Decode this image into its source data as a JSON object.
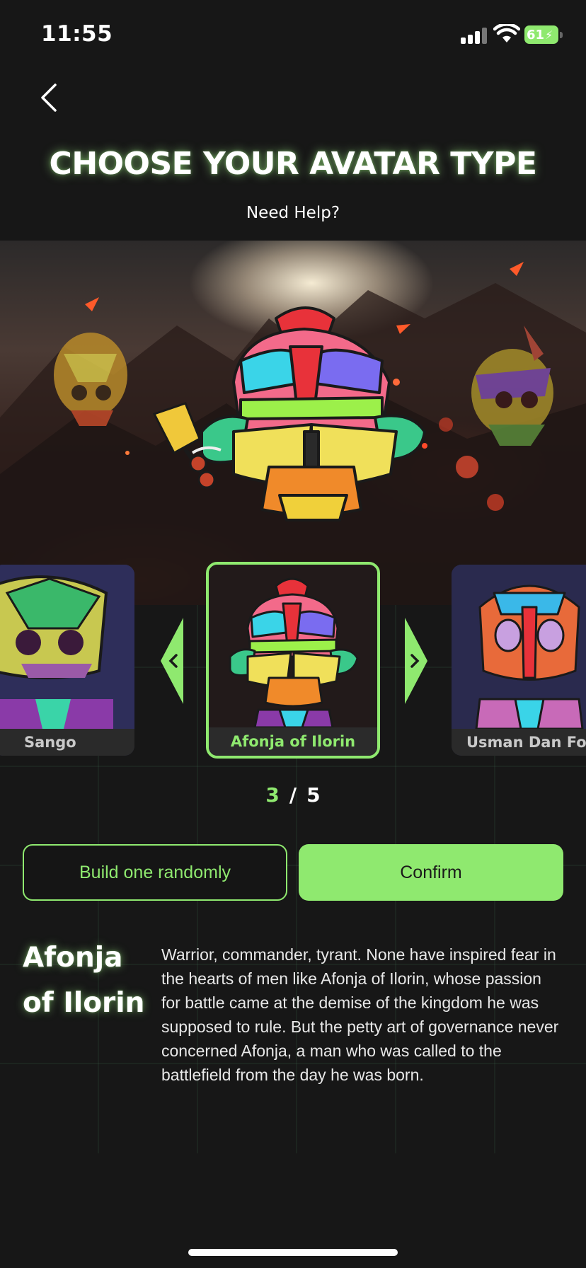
{
  "status_bar": {
    "time": "11:55",
    "battery": "61"
  },
  "header": {
    "title": "CHOOSE YOUR AVATAR TYPE",
    "help_link": "Need Help?"
  },
  "carousel": {
    "items": [
      {
        "label": "Sango"
      },
      {
        "label": "Afonja of Ilorin"
      },
      {
        "label": "Usman Dan Fod"
      }
    ],
    "current": "3",
    "separator": "/",
    "total": "5"
  },
  "actions": {
    "random_label": "Build one randomly",
    "confirm_label": "Confirm"
  },
  "details": {
    "name_line1": "Afonja",
    "name_line2": "of Ilorin",
    "description": "Warrior, commander, tyrant. None have inspired fear in the hearts of men like Afonja of Ilorin, whose passion for battle came at the demise of the kingdom he was supposed to rule. But the petty art of governance never concerned Afonja, a man who was called to the battlefield from the day he was born."
  },
  "colors": {
    "accent": "#8fe96f",
    "background": "#171717"
  },
  "icons": [
    "back-chevron-icon",
    "signal-icon",
    "wifi-icon",
    "battery-icon",
    "chevron-left-icon",
    "chevron-right-icon"
  ]
}
